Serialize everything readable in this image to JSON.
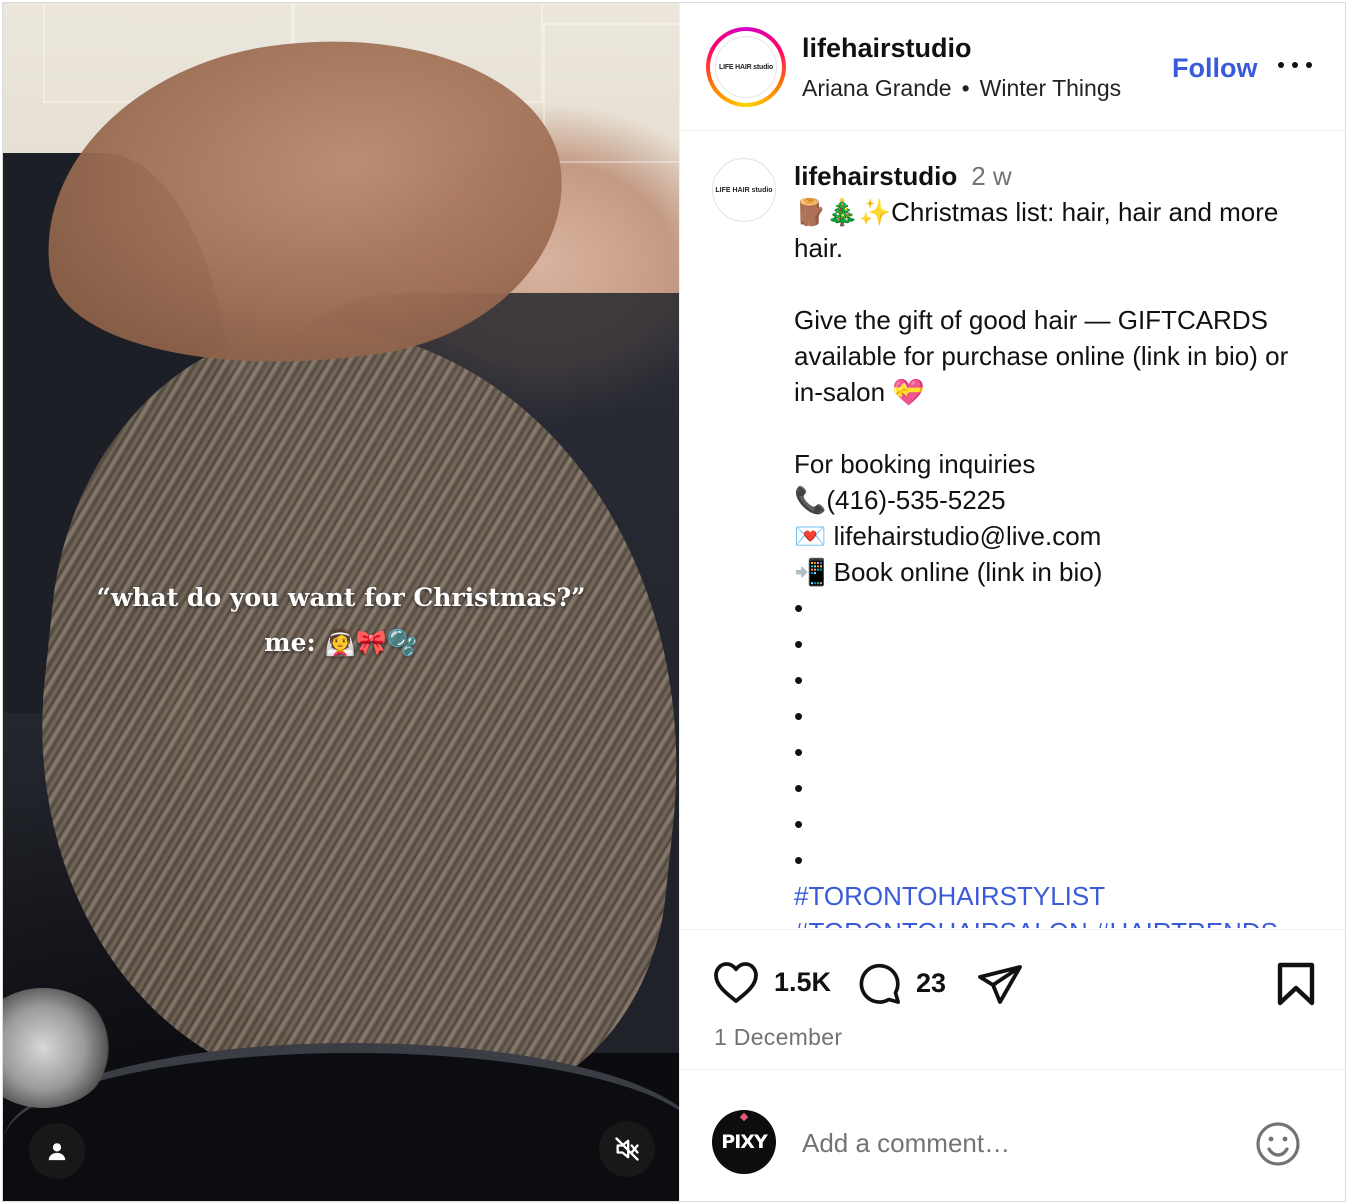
{
  "media": {
    "overlay_line1": "“what do you want for Christmas?”",
    "overlay_line2": "me: 👰🎀🫧",
    "user_tag_icon": "user-icon",
    "mute_icon": "speaker-muted-icon"
  },
  "header": {
    "avatar_text": "LIFE HAIR studio",
    "username": "lifehairstudio",
    "audio_artist": "Ariana Grande",
    "audio_separator": "•",
    "audio_title": "Winter Things",
    "follow_label": "Follow"
  },
  "caption": {
    "avatar_text": "LIFE HAIR studio",
    "username": "lifehairstudio",
    "time": "2 w",
    "lines": [
      "🪵🎄✨Christmas list: hair, hair and more hair.",
      "",
      "Give the gift of good hair — GIFTCARDS available for purchase online (link in bio) or in-salon 💝",
      "",
      "For booking inquiries",
      "📞(416)-535-5225",
      "💌 lifehairstudio@live.com",
      "📲 Book online (link in bio)",
      "•",
      "•",
      "•",
      "•",
      "•",
      "•",
      "•",
      "•"
    ],
    "hashtags_1": "#TORONTOHAIRSTYLIST",
    "hashtags_2": "#TORONTOHAIRSALON #HAIRTRENDS"
  },
  "actions": {
    "likes": "1.5K",
    "comments": "23",
    "date": "1 December"
  },
  "comment_bar": {
    "avatar_text": "PIXY",
    "placeholder": "Add a comment…"
  },
  "colors": {
    "link_blue": "#3a5bd9",
    "muted_gray": "#737373",
    "border": "#efefef"
  }
}
